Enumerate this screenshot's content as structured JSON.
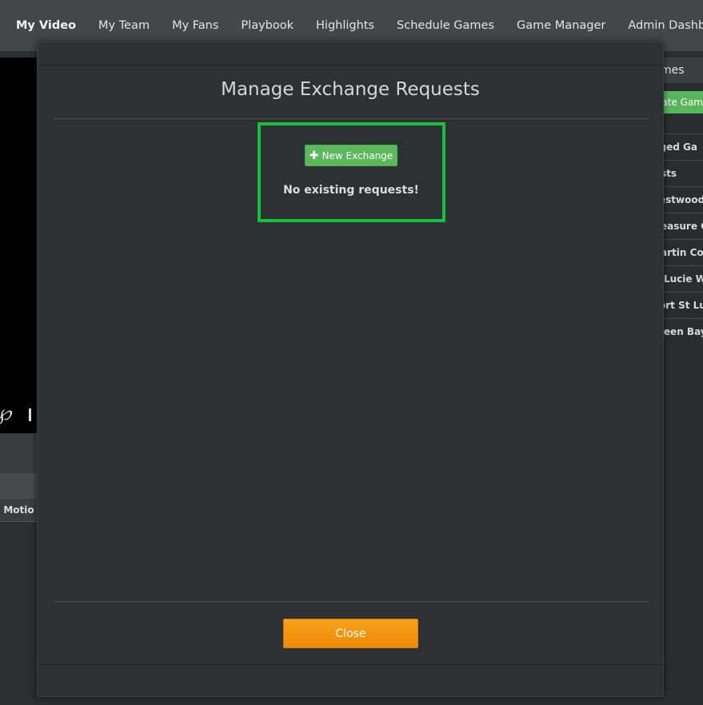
{
  "nav": {
    "items": [
      {
        "label": "My Video",
        "active": true
      },
      {
        "label": "My Team"
      },
      {
        "label": "My Fans"
      },
      {
        "label": "Playbook"
      },
      {
        "label": "Highlights"
      },
      {
        "label": "Schedule Games"
      },
      {
        "label": "Game Manager"
      },
      {
        "label": "Admin Dashboard"
      }
    ]
  },
  "background": {
    "table_header": "e  Motio",
    "right_panel": {
      "title": "mes",
      "button": "eate Gam",
      "rows": [
        "nged Ga",
        "sts",
        "estwood",
        "easure C",
        "artin Cou",
        "Lucie We",
        "ort St Lu",
        "reen Bay"
      ]
    }
  },
  "modal": {
    "title": "Manage Exchange Requests",
    "new_exchange_label": "New Exchange",
    "empty_message": "No existing requests!",
    "close_label": "Close"
  },
  "colors": {
    "accent_green": "#5cb85c",
    "highlight_border": "#18c03a",
    "close_orange": "#f0900a"
  }
}
